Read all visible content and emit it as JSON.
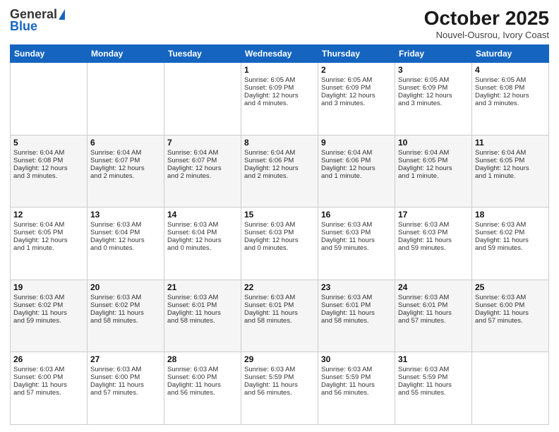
{
  "header": {
    "logo_general": "General",
    "logo_blue": "Blue",
    "month": "October 2025",
    "location": "Nouvel-Ousrou, Ivory Coast"
  },
  "days_of_week": [
    "Sunday",
    "Monday",
    "Tuesday",
    "Wednesday",
    "Thursday",
    "Friday",
    "Saturday"
  ],
  "weeks": [
    [
      {
        "day": "",
        "info": ""
      },
      {
        "day": "",
        "info": ""
      },
      {
        "day": "",
        "info": ""
      },
      {
        "day": "1",
        "info": "Sunrise: 6:05 AM\nSunset: 6:09 PM\nDaylight: 12 hours\nand 4 minutes."
      },
      {
        "day": "2",
        "info": "Sunrise: 6:05 AM\nSunset: 6:09 PM\nDaylight: 12 hours\nand 3 minutes."
      },
      {
        "day": "3",
        "info": "Sunrise: 6:05 AM\nSunset: 6:09 PM\nDaylight: 12 hours\nand 3 minutes."
      },
      {
        "day": "4",
        "info": "Sunrise: 6:05 AM\nSunset: 6:08 PM\nDaylight: 12 hours\nand 3 minutes."
      }
    ],
    [
      {
        "day": "5",
        "info": "Sunrise: 6:04 AM\nSunset: 6:08 PM\nDaylight: 12 hours\nand 3 minutes."
      },
      {
        "day": "6",
        "info": "Sunrise: 6:04 AM\nSunset: 6:07 PM\nDaylight: 12 hours\nand 2 minutes."
      },
      {
        "day": "7",
        "info": "Sunrise: 6:04 AM\nSunset: 6:07 PM\nDaylight: 12 hours\nand 2 minutes."
      },
      {
        "day": "8",
        "info": "Sunrise: 6:04 AM\nSunset: 6:06 PM\nDaylight: 12 hours\nand 2 minutes."
      },
      {
        "day": "9",
        "info": "Sunrise: 6:04 AM\nSunset: 6:06 PM\nDaylight: 12 hours\nand 1 minute."
      },
      {
        "day": "10",
        "info": "Sunrise: 6:04 AM\nSunset: 6:05 PM\nDaylight: 12 hours\nand 1 minute."
      },
      {
        "day": "11",
        "info": "Sunrise: 6:04 AM\nSunset: 6:05 PM\nDaylight: 12 hours\nand 1 minute."
      }
    ],
    [
      {
        "day": "12",
        "info": "Sunrise: 6:04 AM\nSunset: 6:05 PM\nDaylight: 12 hours\nand 1 minute."
      },
      {
        "day": "13",
        "info": "Sunrise: 6:03 AM\nSunset: 6:04 PM\nDaylight: 12 hours\nand 0 minutes."
      },
      {
        "day": "14",
        "info": "Sunrise: 6:03 AM\nSunset: 6:04 PM\nDaylight: 12 hours\nand 0 minutes."
      },
      {
        "day": "15",
        "info": "Sunrise: 6:03 AM\nSunset: 6:03 PM\nDaylight: 12 hours\nand 0 minutes."
      },
      {
        "day": "16",
        "info": "Sunrise: 6:03 AM\nSunset: 6:03 PM\nDaylight: 11 hours\nand 59 minutes."
      },
      {
        "day": "17",
        "info": "Sunrise: 6:03 AM\nSunset: 6:03 PM\nDaylight: 11 hours\nand 59 minutes."
      },
      {
        "day": "18",
        "info": "Sunrise: 6:03 AM\nSunset: 6:02 PM\nDaylight: 11 hours\nand 59 minutes."
      }
    ],
    [
      {
        "day": "19",
        "info": "Sunrise: 6:03 AM\nSunset: 6:02 PM\nDaylight: 11 hours\nand 59 minutes."
      },
      {
        "day": "20",
        "info": "Sunrise: 6:03 AM\nSunset: 6:02 PM\nDaylight: 11 hours\nand 58 minutes."
      },
      {
        "day": "21",
        "info": "Sunrise: 6:03 AM\nSunset: 6:01 PM\nDaylight: 11 hours\nand 58 minutes."
      },
      {
        "day": "22",
        "info": "Sunrise: 6:03 AM\nSunset: 6:01 PM\nDaylight: 11 hours\nand 58 minutes."
      },
      {
        "day": "23",
        "info": "Sunrise: 6:03 AM\nSunset: 6:01 PM\nDaylight: 11 hours\nand 58 minutes."
      },
      {
        "day": "24",
        "info": "Sunrise: 6:03 AM\nSunset: 6:01 PM\nDaylight: 11 hours\nand 57 minutes."
      },
      {
        "day": "25",
        "info": "Sunrise: 6:03 AM\nSunset: 6:00 PM\nDaylight: 11 hours\nand 57 minutes."
      }
    ],
    [
      {
        "day": "26",
        "info": "Sunrise: 6:03 AM\nSunset: 6:00 PM\nDaylight: 11 hours\nand 57 minutes."
      },
      {
        "day": "27",
        "info": "Sunrise: 6:03 AM\nSunset: 6:00 PM\nDaylight: 11 hours\nand 57 minutes."
      },
      {
        "day": "28",
        "info": "Sunrise: 6:03 AM\nSunset: 6:00 PM\nDaylight: 11 hours\nand 56 minutes."
      },
      {
        "day": "29",
        "info": "Sunrise: 6:03 AM\nSunset: 5:59 PM\nDaylight: 11 hours\nand 56 minutes."
      },
      {
        "day": "30",
        "info": "Sunrise: 6:03 AM\nSunset: 5:59 PM\nDaylight: 11 hours\nand 56 minutes."
      },
      {
        "day": "31",
        "info": "Sunrise: 6:03 AM\nSunset: 5:59 PM\nDaylight: 11 hours\nand 55 minutes."
      },
      {
        "day": "",
        "info": ""
      }
    ]
  ]
}
